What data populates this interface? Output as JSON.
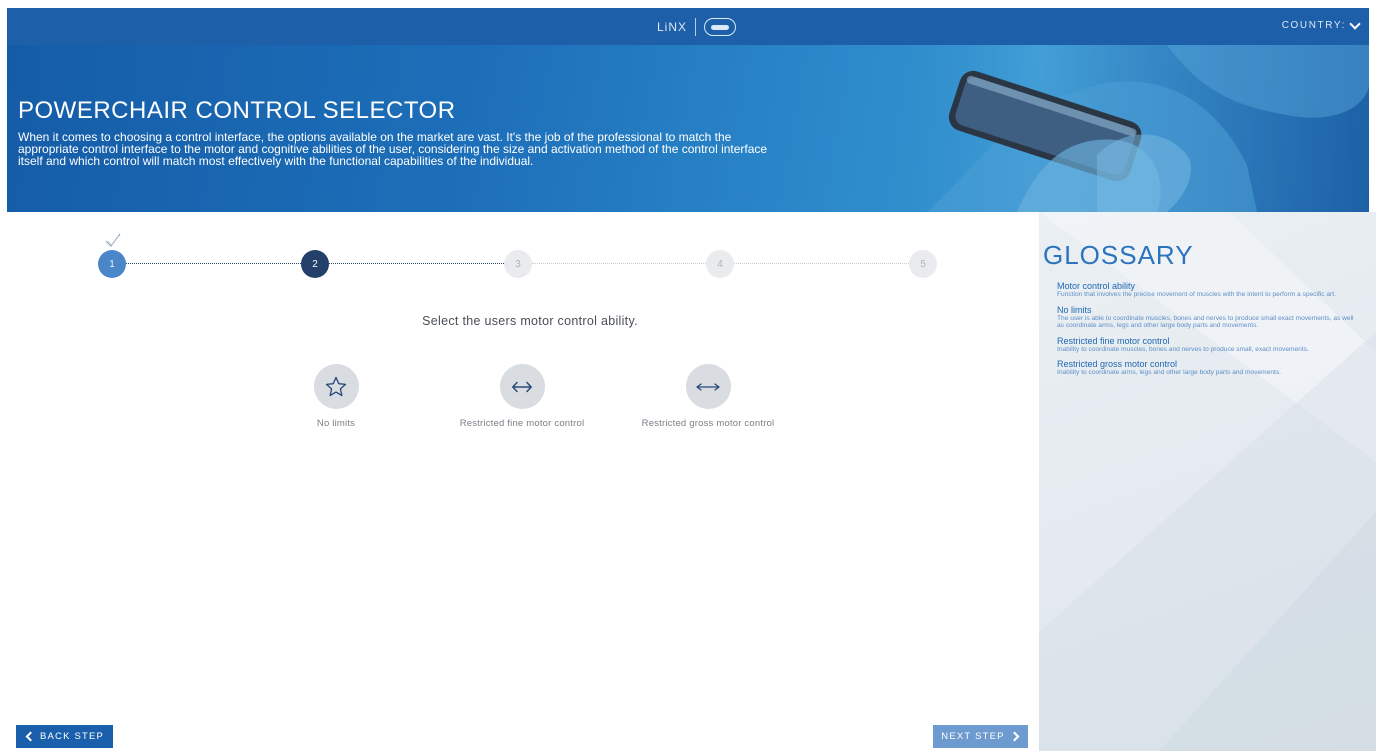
{
  "header": {
    "logo_text": "LiNX",
    "country_label": "COUNTRY:",
    "country_icon": "chevron-down-icon"
  },
  "hero": {
    "title": "POWERCHAIR CONTROL SELECTOR",
    "description": "When it comes to choosing a control interface, the options available on the market are vast. It's the job of the professional to match the appropriate control interface to the motor and cognitive abilities of the user, considering the size and activation method of the control interface itself and which control will match most effectively with the functional capabilities of the individual."
  },
  "stepper": {
    "steps": [
      "1",
      "2",
      "3",
      "4",
      "5"
    ],
    "completed_steps": 1,
    "current_step": 2,
    "colors": {
      "done": "#4a86c8",
      "active": "#23406a",
      "todo": "#e9ebee"
    }
  },
  "question": {
    "prompt": "Select the users motor control ability."
  },
  "options": [
    {
      "label": "No limits",
      "icon": "star-icon"
    },
    {
      "label": "Restricted fine motor control",
      "icon": "double-arrow-icon"
    },
    {
      "label": "Restricted gross motor control",
      "icon": "long-double-arrow-icon"
    }
  ],
  "glossary": {
    "title": "GLOSSARY",
    "entries": [
      {
        "term": "Motor control ability",
        "definition": "Function that involves the precise movement of muscles with the intent to perform a specific art."
      },
      {
        "term": "No limits",
        "definition": "The user is able to coordinate muscles, bones and nerves to produce small exact movements, as well as coordinate arms, legs and other large body parts and movements."
      },
      {
        "term": "Restricted fine motor control",
        "definition": "Inability to coordinate muscles, bones and nerves to produce small, exact movements."
      },
      {
        "term": "Restricted gross motor control",
        "definition": "Inability to coordinate arms, legs and other large body parts and movements."
      }
    ]
  },
  "nav": {
    "back_label": "BACK STEP",
    "next_label": "NEXT STEP"
  },
  "colors": {
    "brand_blue": "#1d5fa8",
    "glossary_blue": "#2b73bd"
  }
}
